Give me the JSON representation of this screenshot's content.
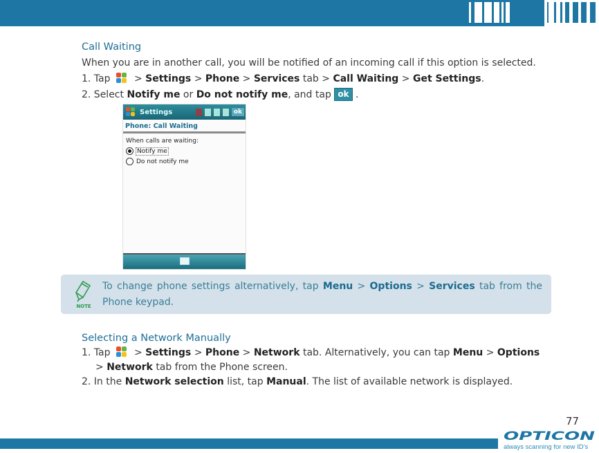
{
  "header": {
    "decoration": "barcode-pattern"
  },
  "call_waiting": {
    "heading": "Call Waiting",
    "intro": "When you are in another call, you will be notified of an incoming call if this option is selected.",
    "step1": {
      "prefix": "1. Tap",
      "start_icon": "windows-start-icon",
      "sep": ">",
      "items": [
        "Settings",
        "Phone",
        "Services"
      ],
      "tab_word": "tab",
      "items2": [
        "Call Waiting",
        "Get Settings"
      ],
      "end": "."
    },
    "step2": {
      "prefix": "2. Select",
      "opt1": "Notify me",
      "or": "or",
      "opt2": "Do not notify me",
      "tap": ", and tap",
      "ok_label": "ok",
      "end": "."
    }
  },
  "phone_screen": {
    "title": "Settings",
    "ok": "ok",
    "page_header": "Phone: Call Waiting",
    "label": "When calls are waiting:",
    "options": [
      {
        "label": "Notify me",
        "selected": true
      },
      {
        "label": "Do not notify me",
        "selected": false
      }
    ]
  },
  "note": {
    "badge": "NOTE",
    "text_a": "To change phone settings alternatively, tap",
    "menu": "Menu",
    "sep": ">",
    "options": "Options",
    "services": "Services",
    "text_b": "tab from the Phone keypad."
  },
  "network": {
    "heading": "Selecting a Network Manually",
    "step1": {
      "prefix": "1. Tap",
      "sep": ">",
      "settings": "Settings",
      "phone": "Phone",
      "network": "Network",
      "text_a": "tab. Alternatively, you can tap",
      "menu": "Menu",
      "options": "Options",
      "text_b": "tab from the Phone screen."
    },
    "step2": {
      "prefix": "2. In the",
      "list": "Network selection",
      "text_a": "list, tap",
      "manual": "Manual",
      "text_b": ". The list of available network is displayed."
    }
  },
  "footer": {
    "page_number": "77",
    "brand": "OPTICON",
    "tagline": "always scanning for new ID's"
  },
  "colors": {
    "accent": "#1d76a3",
    "note_bg": "#d4e1ea",
    "heading": "#1d6e97"
  }
}
